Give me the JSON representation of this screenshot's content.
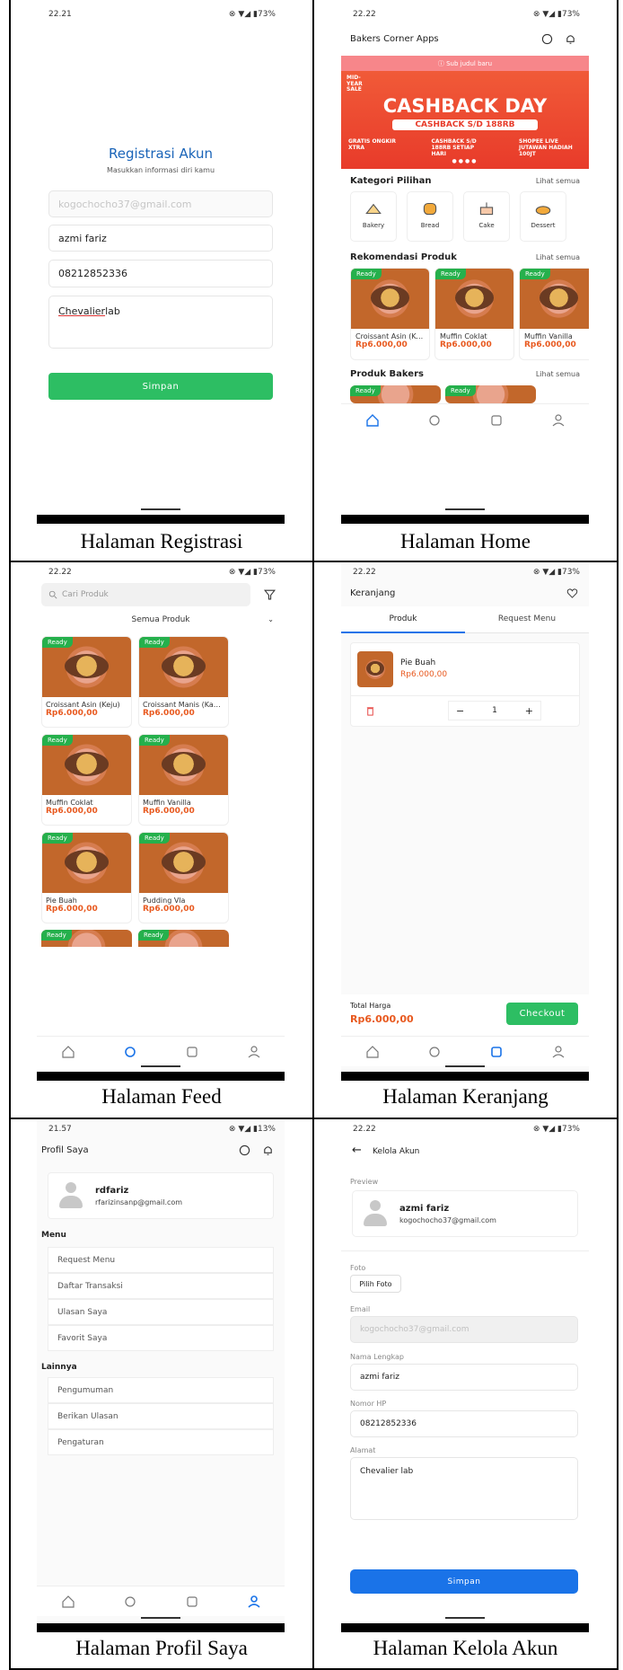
{
  "captions": {
    "registrasi": "Halaman Registrasi",
    "home": "Halaman Home",
    "feed": "Halaman Feed",
    "keranjang": "Halaman Keranjang",
    "profil": "Halaman Profil Saya",
    "kelola": "Halaman Kelola Akun"
  },
  "registrasi": {
    "time": "22.21",
    "battery": "73%",
    "title": "Registrasi Akun",
    "subtitle": "Masukkan informasi diri kamu",
    "email": "kogochocho37@gmail.com",
    "name": "azmi fariz",
    "phone": "08212852336",
    "address_word1": "Chevalier",
    "address_word2": " lab",
    "save": "Simpan"
  },
  "home": {
    "time": "22.22",
    "battery": "73%",
    "app_title": "Bakers Corner Apps",
    "banner_notice": "Sub judul baru",
    "banner_corner": "MID-YEAR SALE",
    "banner_title": "CASHBACK DAY",
    "banner_sub": "CASHBACK S/D 188RB",
    "promo1": "GRATIS ONGKIR XTRA",
    "promo2": "CASHBACK S/D 188RB SETIAP HARI",
    "promo3": "SHOPEE LIVE JUTAWAN HADIAH 100JT",
    "section1": "Kategori Pilihan",
    "see_all": "Lihat semua",
    "categories": [
      "Bakery",
      "Bread",
      "Cake",
      "Dessert"
    ],
    "section2": "Rekomendasi Produk",
    "products": [
      {
        "name": "Croissant Asin (Keju)",
        "price": "Rp6.000,00"
      },
      {
        "name": "Muffin Coklat",
        "price": "Rp6.000,00"
      },
      {
        "name": "Muffin Vanilla",
        "price": "Rp6.000,00"
      }
    ],
    "ready": "Ready",
    "section3": "Produk Bakers"
  },
  "feed": {
    "time": "22.22",
    "battery": "73%",
    "search_placeholder": "Cari Produk",
    "filter": "Semua Produk",
    "ready": "Ready",
    "products": [
      {
        "name": "Croissant Asin (Keju)",
        "price": "Rp6.000,00"
      },
      {
        "name": "Croissant Manis (Kacang)",
        "price": "Rp6.000,00"
      },
      {
        "name": "Muffin Coklat",
        "price": "Rp6.000,00"
      },
      {
        "name": "Muffin Vanilla",
        "price": "Rp6.000,00"
      },
      {
        "name": "Pie Buah",
        "price": "Rp6.000,00"
      },
      {
        "name": "Pudding Vla",
        "price": "Rp6.000,00"
      }
    ]
  },
  "keranjang": {
    "time": "22.22",
    "battery": "73%",
    "title": "Keranjang",
    "tab1": "Produk",
    "tab2": "Request Menu",
    "item_name": "Pie Buah",
    "item_price": "Rp6.000,00",
    "qty": "1",
    "total_label": "Total Harga",
    "total": "Rp6.000,00",
    "checkout": "Checkout"
  },
  "profil": {
    "time": "21.57",
    "battery": "13%",
    "title": "Profil Saya",
    "user": "rdfariz",
    "email": "rfarizinsanp@gmail.com",
    "menu_title": "Menu",
    "menu": [
      "Request Menu",
      "Daftar Transaksi",
      "Ulasan Saya",
      "Favorit Saya"
    ],
    "other_title": "Lainnya",
    "other": [
      "Pengumuman",
      "Berikan Ulasan",
      "Pengaturan"
    ]
  },
  "kelola": {
    "time": "22.22",
    "battery": "73%",
    "title": "Kelola Akun",
    "preview_label": "Preview",
    "name": "azmi fariz",
    "email": "kogochocho37@gmail.com",
    "photo_label": "Foto",
    "photo_button": "Pilih Foto",
    "email_label": "Email",
    "name_label": "Nama Lengkap",
    "phone_label": "Nomor HP",
    "phone": "08212852336",
    "address_label": "Alamat",
    "address": "Chevalier lab",
    "save": "Simpan"
  },
  "colors": {
    "green": "#2dbe63",
    "orange": "#e8591f",
    "blue": "#1a73e8",
    "banner_red": "#f04a3b"
  }
}
